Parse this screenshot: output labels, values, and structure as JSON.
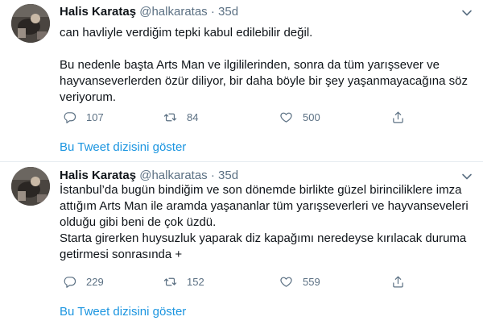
{
  "tweets": [
    {
      "author_name": "Halis Karataş",
      "handle": "@halkaratas",
      "separator": "·",
      "time": "35d",
      "lines": [
        "can havliyle verdiğim tepki kabul edilebilir değil.",
        "",
        "Bu nedenle başta Arts Man ve ilgililerinden, sonra da tüm yarışsever ve",
        "hayvanseverlerden özür diliyor,  bir daha böyle bir şey yaşanmayacağına söz",
        "veriyorum."
      ],
      "replies": "107",
      "retweets": "84",
      "likes": "500",
      "thread_link": "Bu Tweet dizisini göster"
    },
    {
      "author_name": "Halis Karataş",
      "handle": "@halkaratas",
      "separator": "·",
      "time": "35d",
      "lines": [
        "İstanbul’da bugün bindiğim ve son dönemde birlikte güzel birinciliklere imza",
        "attığım Arts Man ile aramda yaşananlar tüm yarışseverleri ve hayvanseveleri",
        "olduğu gibi beni de çok üzdü.",
        "Starta girerken huysuzluk yaparak diz kapağımı neredeyse kırılacak duruma",
        "getirmesi sonrasında +"
      ],
      "replies": "229",
      "retweets": "152",
      "likes": "559",
      "thread_link": "Bu Tweet dizisini göster"
    }
  ],
  "icons": {
    "reply": "reply-icon",
    "retweet": "retweet-icon",
    "like": "heart-icon",
    "share": "share-icon",
    "more": "chevron-down-icon"
  },
  "colors": {
    "link": "#1b95e0",
    "secondary_text": "#5b7083",
    "divider": "#e6ecf0"
  }
}
